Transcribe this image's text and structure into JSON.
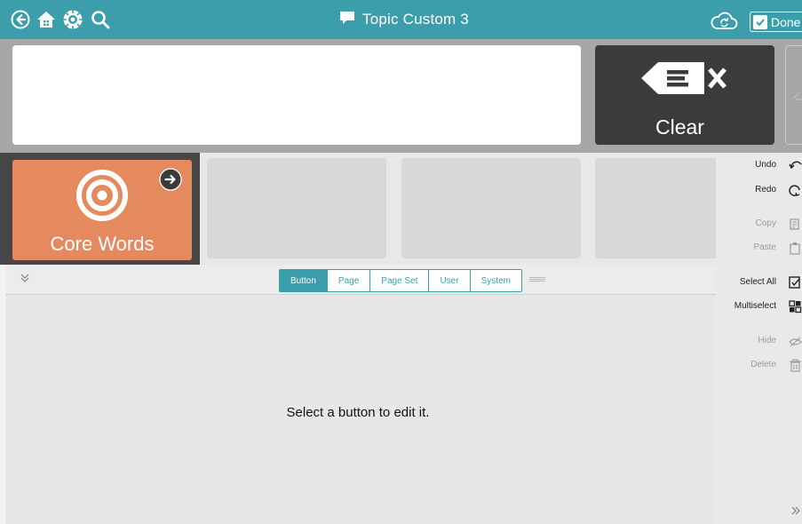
{
  "topbar": {
    "icons": [
      "back-icon",
      "home-icon",
      "settings-icon",
      "search-icon"
    ],
    "title": "Topic Custom 3",
    "title_icon": "speech-bubble-icon",
    "sync_icon": "cloud-sync-icon",
    "done_label": "Done",
    "color": "#3d9eab"
  },
  "message_bar": {
    "clear_label": "Clear",
    "clear_icon": "erase-x-icon"
  },
  "grid": {
    "core_button": {
      "label": "Core Words",
      "icon": "target-icon",
      "link_icon": "arrow-right-circle-icon",
      "color": "#e58a5f"
    },
    "empty_cells": 3
  },
  "side_panel": {
    "undo": "Undo",
    "redo": "Redo",
    "copy": "Copy",
    "paste": "Paste",
    "select_all": "Select All",
    "multiselect": "Multiselect",
    "hide": "Hide",
    "delete": "Delete"
  },
  "tabs": [
    {
      "label": "Button",
      "active": true
    },
    {
      "label": "Page",
      "active": false
    },
    {
      "label": "Page Set",
      "active": false
    },
    {
      "label": "User",
      "active": false
    },
    {
      "label": "System",
      "active": false
    }
  ],
  "edit_area": {
    "message": "Select a button to edit it."
  }
}
